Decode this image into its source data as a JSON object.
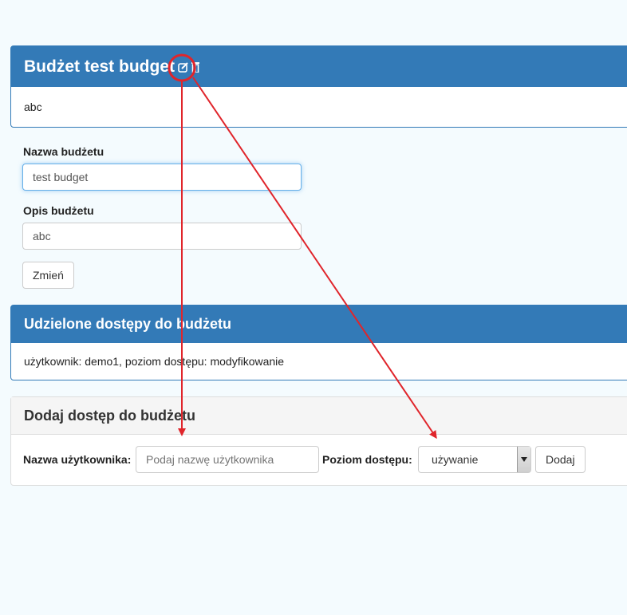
{
  "budget_panel": {
    "title": "Budżet test budget",
    "description": "abc",
    "icons": [
      "edit-icon",
      "trash-icon"
    ]
  },
  "form": {
    "name_label": "Nazwa budżetu",
    "name_value": "test budget",
    "description_label": "Opis budżetu",
    "description_value": "abc",
    "submit_label": "Zmień"
  },
  "access_panel": {
    "title": "Udzielone dostępy do budżetu",
    "entries": [
      "użytkownik: demo1, poziom dostępu: modyfikowanie"
    ]
  },
  "add_access_panel": {
    "title": "Dodaj dostęp do budżetu",
    "username_label": "Nazwa użytkownika:",
    "username_placeholder": "Podaj nazwę użytkownika",
    "level_label": "Poziom dostępu:",
    "level_selected": "używanie",
    "add_label": "Dodaj"
  },
  "colors": {
    "primary": "#337ab7",
    "annotation": "#e0252b",
    "page_background": "#f4fbfe"
  }
}
